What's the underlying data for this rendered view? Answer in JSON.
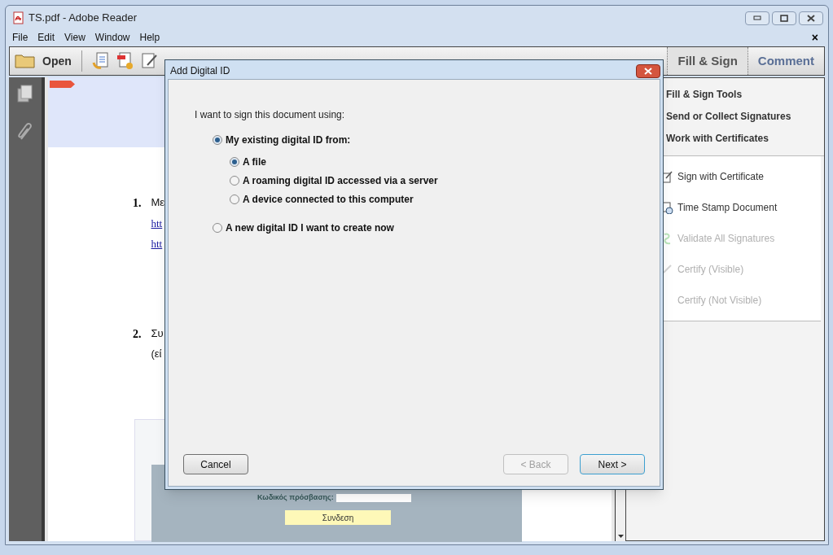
{
  "window": {
    "title": "TS.pdf - Adobe Reader"
  },
  "menu": [
    {
      "label": "File"
    },
    {
      "label": "Edit"
    },
    {
      "label": "View"
    },
    {
      "label": "Window"
    },
    {
      "label": "Help"
    }
  ],
  "document_close": "×",
  "toolbar": {
    "open_label": "Open"
  },
  "tabs": [
    {
      "label": "Fill & Sign",
      "selected": true
    },
    {
      "label": "Comment",
      "selected": false
    }
  ],
  "side_panel": {
    "sections": [
      {
        "label": "Fill & Sign Tools"
      },
      {
        "label": "Send or Collect Signatures"
      },
      {
        "label": "Work with Certificates"
      }
    ],
    "tools": [
      {
        "label": "Sign with Certificate",
        "disabled": false,
        "kind": "sign"
      },
      {
        "label": "Time Stamp Document",
        "disabled": false,
        "kind": "clock"
      },
      {
        "label": "Validate All Signatures",
        "disabled": true,
        "kind": "validate"
      },
      {
        "label": "Certify (Visible)",
        "disabled": true,
        "kind": "pen"
      },
      {
        "label": "Certify (Not Visible)",
        "disabled": true,
        "kind": "none"
      }
    ]
  },
  "document": {
    "items": [
      {
        "number": "1.",
        "lines": [
          {
            "text": "Με",
            "kind": "text"
          },
          {
            "text": "htt",
            "kind": "link"
          },
          {
            "text": "htt",
            "kind": "link"
          }
        ]
      },
      {
        "number": "2.",
        "lines": [
          {
            "text": "Συ",
            "kind": "text"
          },
          {
            "text": "(εί",
            "kind": "text"
          }
        ]
      }
    ],
    "login_form": {
      "password_label": "Κωδικός πρόσβασης:",
      "button": "Συνδεση"
    }
  },
  "dialog": {
    "title": "Add Digital ID",
    "prompt": "I want to sign this document using:",
    "options": [
      {
        "label": "My existing digital ID from:",
        "selected": true,
        "children": [
          {
            "label": "A file",
            "selected": true
          },
          {
            "label": "A roaming digital ID accessed via a server",
            "selected": false
          },
          {
            "label": "A device connected to this computer",
            "selected": false
          }
        ]
      },
      {
        "label": "A new digital ID I want to create now",
        "selected": false
      }
    ],
    "buttons": [
      {
        "label": "Cancel",
        "kind": "cancel",
        "disabled": false
      },
      {
        "label": "< Back",
        "kind": "back",
        "disabled": true
      },
      {
        "label": "Next >",
        "kind": "next",
        "disabled": false
      }
    ]
  }
}
